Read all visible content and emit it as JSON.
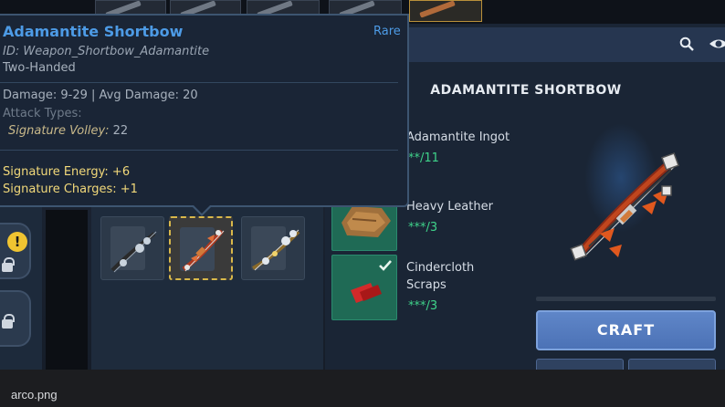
{
  "tooltip": {
    "title": "Adamantite Shortbow",
    "rarity": "Rare",
    "id_line": "ID: Weapon_Shortbow_Adamantite",
    "handedness": "Two-Handed",
    "damage_line": "Damage: 9-29 | Avg Damage: 20",
    "attack_types_label": "Attack Types:",
    "signature_volley_name": "Signature Volley:",
    "signature_volley_value": "22",
    "signature_energy": "Signature Energy: +6",
    "signature_charges": "Signature Charges: +1"
  },
  "left_panel": {
    "warning_badge": "!"
  },
  "recipe": {
    "title": "ADAMANTITE SHORTBOW",
    "materials": [
      {
        "name": "Adamantite Ingot",
        "count": "**/11",
        "icon": "ingot-icon"
      },
      {
        "name": "Heavy Leather",
        "count": "***/3",
        "icon": "leather-icon"
      },
      {
        "name_line1": "Cindercloth",
        "name_line2": "Scraps",
        "count": "***/3",
        "icon": "cloth-icon"
      }
    ],
    "craft_label": "CRAFT"
  },
  "colors": {
    "rarity_blue": "#4d9be6",
    "count_green": "#3fd38a",
    "signature_gold": "#f2d97a",
    "craft_button": "#5a80c4",
    "material_box": "#1f6a55",
    "selected_border": "#d9b84a"
  },
  "footer": {
    "filename": "arco.png"
  }
}
